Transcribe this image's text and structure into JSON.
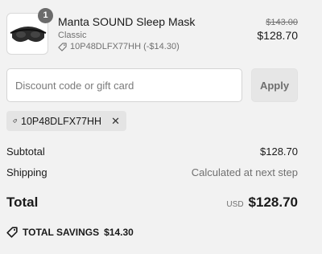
{
  "product": {
    "quantity": "1",
    "name": "Manta SOUND Sleep Mask",
    "variant": "Classic",
    "discount_line": "10P48DLFX77HH (-$14.30)",
    "original_price": "$143.00",
    "price": "$128.70",
    "image_icon": "sleep-mask-image"
  },
  "discount": {
    "placeholder": "Discount code or gift card",
    "value": "",
    "apply_label": "Apply"
  },
  "applied_code": {
    "code": "10P48DLFX77HH",
    "tag_icon": "tag-icon",
    "remove_icon": "close-icon"
  },
  "summary": {
    "subtotal_label": "Subtotal",
    "subtotal_value": "$128.70",
    "shipping_label": "Shipping",
    "shipping_value": "Calculated at next step",
    "total_label": "Total",
    "currency": "USD",
    "total_value": "$128.70"
  },
  "savings": {
    "label": "TOTAL SAVINGS",
    "amount": "$14.30",
    "icon": "tag-icon"
  },
  "colors": {
    "background": "#f2f2f2",
    "chip": "#e4e4e4",
    "muted_text": "#707070",
    "badge": "#6b6b6b"
  }
}
